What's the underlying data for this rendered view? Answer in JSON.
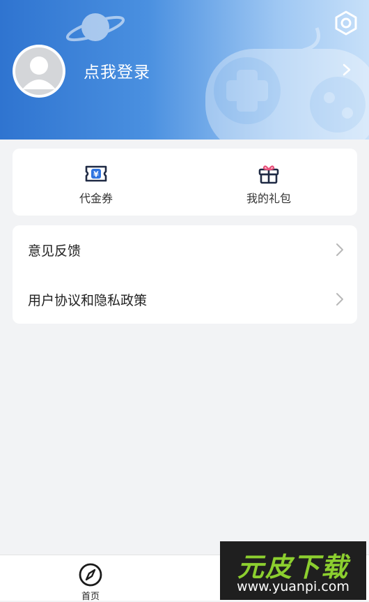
{
  "header": {
    "login_label": "点我登录",
    "gradient_start": "#2f74d0",
    "gradient_end": "#c7e0f9"
  },
  "quick_actions": [
    {
      "label": "代金券",
      "icon": "voucher-icon"
    },
    {
      "label": "我的礼包",
      "icon": "gift-icon"
    }
  ],
  "menu": [
    {
      "label": "意见反馈"
    },
    {
      "label": "用户协议和隐私政策"
    }
  ],
  "tabbar": [
    {
      "label": "首页",
      "icon": "compass-icon"
    }
  ],
  "watermark": {
    "brand": "元皮下载",
    "url": "www.yuanpi.com"
  }
}
